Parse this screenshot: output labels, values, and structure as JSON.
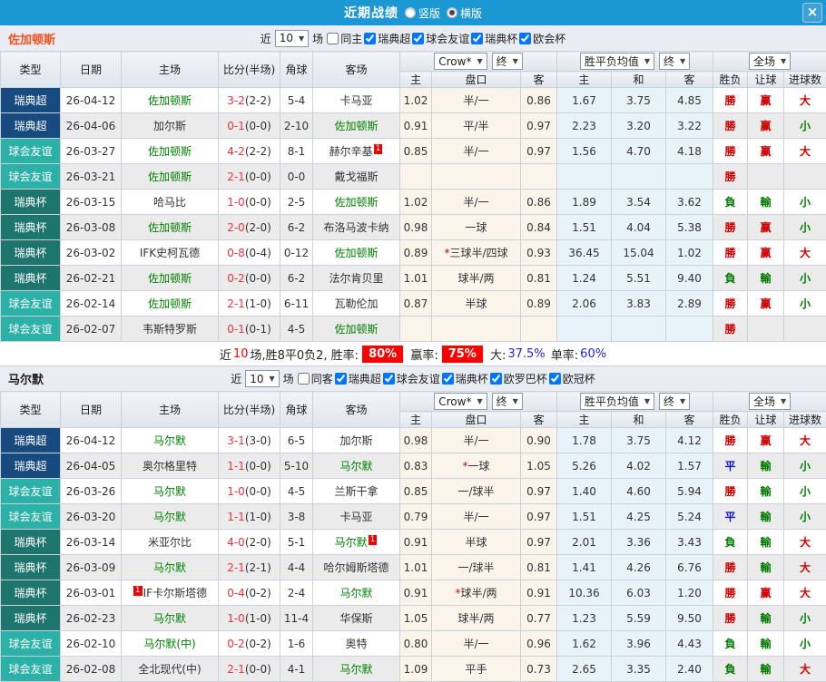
{
  "titlebar": {
    "title": "近期战绩",
    "radio_vertical": "竖版",
    "radio_horizontal": "横版",
    "selected": "横版",
    "close": "×"
  },
  "table_headers": {
    "type": "类型",
    "date": "日期",
    "home": "主场",
    "score": "比分(半场)",
    "corner": "角球",
    "away": "客场",
    "odds_home": "主",
    "handicap": "盘口",
    "odds_away": "客",
    "mean_home": "主",
    "mean_draw": "和",
    "mean_away": "客",
    "result": "胜负",
    "handicap_result": "让球",
    "goals": "进球数",
    "select_crow": "Crow*",
    "select_final1": "终",
    "select_mean": "胜平负均值",
    "select_final2": "终",
    "select_scope": "全场"
  },
  "result_colors": {
    "勝": "#d00000",
    "負": "#007a00",
    "平": "#1414cc",
    "赢": "#d00000",
    "輸": "#007a00",
    "大": "#d00000",
    "小": "#007a00"
  },
  "league_colors": {
    "瑞典超": "#174a7f",
    "球会友谊": "#2cb1a8",
    "瑞典杯": "#1e756e"
  },
  "sections": [
    {
      "team": "佐加顿斯",
      "team_color": "#f94e1c",
      "filters": {
        "near_label": "近",
        "matches": "10",
        "unit_label": "场",
        "checkboxes": [
          {
            "label": "同主",
            "checked": false
          },
          {
            "label": "瑞典超",
            "checked": true
          },
          {
            "label": "球会友谊",
            "checked": true
          },
          {
            "label": "瑞典杯",
            "checked": true
          },
          {
            "label": "欧会杯",
            "checked": true
          }
        ]
      },
      "rows": [
        {
          "type": "瑞典超",
          "date": "26-04-12",
          "home": {
            "name": "佐加顿斯",
            "focus": true
          },
          "score": "3-2",
          "half": "(2-2)",
          "corner": "5-4",
          "away": {
            "name": "卡马亚"
          },
          "o1": "1.02",
          "hcap": "半/一",
          "o2": "0.86",
          "m1": "1.67",
          "m2": "3.75",
          "m3": "4.85",
          "res": "勝",
          "hres": "赢",
          "goals": "大"
        },
        {
          "type": "瑞典超",
          "date": "26-04-06",
          "home": {
            "name": "加尔斯"
          },
          "score": "0-1",
          "half": "(0-0)",
          "corner": "2-10",
          "away": {
            "name": "佐加顿斯",
            "focus": true
          },
          "o1": "0.91",
          "hcap": "平/半",
          "o2": "0.97",
          "m1": "2.23",
          "m2": "3.20",
          "m3": "3.22",
          "res": "勝",
          "hres": "赢",
          "goals": "小"
        },
        {
          "type": "球会友谊",
          "date": "26-03-27",
          "home": {
            "name": "佐加顿斯",
            "focus": true
          },
          "score": "4-2",
          "half": "(2-2)",
          "corner": "8-1",
          "away": {
            "name": "赫尔辛基",
            "sup": "1"
          },
          "o1": "0.85",
          "hcap": "半/一",
          "o2": "0.97",
          "m1": "1.56",
          "m2": "4.70",
          "m3": "4.18",
          "res": "勝",
          "hres": "赢",
          "goals": "大"
        },
        {
          "type": "球会友谊",
          "date": "26-03-21",
          "home": {
            "name": "佐加顿斯",
            "focus": true
          },
          "score": "2-1",
          "half": "(0-0)",
          "corner": "0-0",
          "away": {
            "name": "戴戈福斯"
          },
          "o1": "",
          "hcap": "",
          "o2": "",
          "m1": "",
          "m2": "",
          "m3": "",
          "res": "勝",
          "hres": "",
          "goals": ""
        },
        {
          "type": "瑞典杯",
          "date": "26-03-15",
          "home": {
            "name": "哈马比"
          },
          "score": "1-0",
          "half": "(0-0)",
          "corner": "2-5",
          "away": {
            "name": "佐加顿斯",
            "focus": true
          },
          "o1": "1.02",
          "hcap": "半/一",
          "o2": "0.86",
          "m1": "1.89",
          "m2": "3.54",
          "m3": "3.62",
          "res": "負",
          "hres": "輸",
          "goals": "小"
        },
        {
          "type": "瑞典杯",
          "date": "26-03-08",
          "home": {
            "name": "佐加顿斯",
            "focus": true
          },
          "score": "2-0",
          "half": "(2-0)",
          "corner": "6-2",
          "away": {
            "name": "布洛马波卡纳"
          },
          "o1": "0.98",
          "hcap": "一球",
          "o2": "0.84",
          "m1": "1.51",
          "m2": "4.04",
          "m3": "5.38",
          "res": "勝",
          "hres": "赢",
          "goals": "小"
        },
        {
          "type": "瑞典杯",
          "date": "26-03-02",
          "home": {
            "name": "IFK史柯瓦德"
          },
          "score": "0-8",
          "half": "(0-4)",
          "corner": "0-12",
          "away": {
            "name": "佐加顿斯",
            "focus": true
          },
          "o1": "0.89",
          "hcap": "*三球半/四球",
          "o2": "0.93",
          "m1": "36.45",
          "m2": "15.04",
          "m3": "1.02",
          "res": "勝",
          "hres": "赢",
          "goals": "大"
        },
        {
          "type": "瑞典杯",
          "date": "26-02-21",
          "home": {
            "name": "佐加顿斯",
            "focus": true
          },
          "score": "0-2",
          "half": "(0-0)",
          "corner": "6-2",
          "away": {
            "name": "法尔肯贝里"
          },
          "o1": "1.01",
          "hcap": "球半/两",
          "o2": "0.81",
          "m1": "1.24",
          "m2": "5.51",
          "m3": "9.40",
          "res": "負",
          "hres": "輸",
          "goals": "小"
        },
        {
          "type": "球会友谊",
          "date": "26-02-14",
          "home": {
            "name": "佐加顿斯",
            "focus": true
          },
          "score": "2-1",
          "half": "(1-0)",
          "corner": "6-11",
          "away": {
            "name": "瓦勒伦加"
          },
          "o1": "0.87",
          "hcap": "半球",
          "o2": "0.89",
          "m1": "2.06",
          "m2": "3.83",
          "m3": "2.89",
          "res": "勝",
          "hres": "赢",
          "goals": "小"
        },
        {
          "type": "球会友谊",
          "date": "26-02-07",
          "home": {
            "name": "韦斯特罗斯"
          },
          "score": "0-1",
          "half": "(0-1)",
          "corner": "4-5",
          "away": {
            "name": "佐加顿斯",
            "focus": true
          },
          "o1": "",
          "hcap": "",
          "o2": "",
          "m1": "",
          "m2": "",
          "m3": "",
          "res": "勝",
          "hres": "",
          "goals": ""
        }
      ],
      "summary": {
        "p1": "近",
        "p2": "10",
        "p3": "场,胜8平0负2, 胜率:",
        "p4": "80%",
        "p5": " 赢率:",
        "p6": "75%",
        "p7": " 大:",
        "p8": "37.5%",
        "p9": " 单率:",
        "p10": "60%"
      }
    },
    {
      "team": "马尔默",
      "team_color": "#222222",
      "filters": {
        "near_label": "近",
        "matches": "10",
        "unit_label": "场",
        "checkboxes": [
          {
            "label": "同客",
            "checked": false
          },
          {
            "label": "瑞典超",
            "checked": true
          },
          {
            "label": "球会友谊",
            "checked": true
          },
          {
            "label": "瑞典杯",
            "checked": true
          },
          {
            "label": "欧罗巴杯",
            "checked": true
          },
          {
            "label": "欧冠杯",
            "checked": true
          }
        ]
      },
      "rows": [
        {
          "type": "瑞典超",
          "date": "26-04-12",
          "home": {
            "name": "马尔默",
            "focus": true
          },
          "score": "3-1",
          "half": "(3-0)",
          "corner": "6-5",
          "away": {
            "name": "加尔斯"
          },
          "o1": "0.98",
          "hcap": "半/一",
          "o2": "0.90",
          "m1": "1.78",
          "m2": "3.75",
          "m3": "4.12",
          "res": "勝",
          "hres": "赢",
          "goals": "大"
        },
        {
          "type": "瑞典超",
          "date": "26-04-05",
          "home": {
            "name": "奥尔格里特"
          },
          "score": "1-1",
          "half": "(0-0)",
          "corner": "5-10",
          "away": {
            "name": "马尔默",
            "focus": true
          },
          "o1": "0.83",
          "hcap": "*一球",
          "o2": "1.05",
          "m1": "5.26",
          "m2": "4.02",
          "m3": "1.57",
          "res": "平",
          "hres": "輸",
          "goals": "小"
        },
        {
          "type": "球会友谊",
          "date": "26-03-26",
          "home": {
            "name": "马尔默",
            "focus": true
          },
          "score": "1-0",
          "half": "(0-0)",
          "corner": "4-5",
          "away": {
            "name": "兰斯干拿"
          },
          "o1": "0.85",
          "hcap": "一/球半",
          "o2": "0.97",
          "m1": "1.40",
          "m2": "4.60",
          "m3": "5.94",
          "res": "勝",
          "hres": "輸",
          "goals": "小"
        },
        {
          "type": "球会友谊",
          "date": "26-03-20",
          "home": {
            "name": "马尔默",
            "focus": true
          },
          "score": "1-1",
          "half": "(1-0)",
          "corner": "3-8",
          "away": {
            "name": "卡马亚"
          },
          "o1": "0.79",
          "hcap": "半/一",
          "o2": "0.97",
          "m1": "1.51",
          "m2": "4.25",
          "m3": "5.24",
          "res": "平",
          "hres": "輸",
          "goals": "小"
        },
        {
          "type": "瑞典杯",
          "date": "26-03-14",
          "home": {
            "name": "米亚尔比"
          },
          "score": "4-0",
          "half": "(2-0)",
          "corner": "5-1",
          "away": {
            "name": "马尔默",
            "focus": true,
            "sup": "1"
          },
          "o1": "0.91",
          "hcap": "半球",
          "o2": "0.97",
          "m1": "2.01",
          "m2": "3.36",
          "m3": "3.43",
          "res": "負",
          "hres": "輸",
          "goals": "大"
        },
        {
          "type": "瑞典杯",
          "date": "26-03-09",
          "home": {
            "name": "马尔默",
            "focus": true
          },
          "score": "2-1",
          "half": "(2-1)",
          "corner": "4-4",
          "away": {
            "name": "哈尔姆斯塔德"
          },
          "o1": "1.01",
          "hcap": "一/球半",
          "o2": "0.81",
          "m1": "1.41",
          "m2": "4.26",
          "m3": "6.76",
          "res": "勝",
          "hres": "輸",
          "goals": "大"
        },
        {
          "type": "瑞典杯",
          "date": "26-03-01",
          "home": {
            "name": "IF卡尔斯塔德",
            "sup": "1",
            "sup_before": true
          },
          "score": "0-4",
          "half": "(0-2)",
          "corner": "2-4",
          "away": {
            "name": "马尔默",
            "focus": true
          },
          "o1": "0.91",
          "hcap": "*球半/两",
          "o2": "0.91",
          "m1": "10.36",
          "m2": "6.03",
          "m3": "1.20",
          "res": "勝",
          "hres": "赢",
          "goals": "大"
        },
        {
          "type": "瑞典杯",
          "date": "26-02-23",
          "home": {
            "name": "马尔默",
            "focus": true
          },
          "score": "1-0",
          "half": "(1-0)",
          "corner": "11-4",
          "away": {
            "name": "华保斯"
          },
          "o1": "1.05",
          "hcap": "球半/两",
          "o2": "0.77",
          "m1": "1.23",
          "m2": "5.59",
          "m3": "9.50",
          "res": "勝",
          "hres": "輸",
          "goals": "小"
        },
        {
          "type": "球会友谊",
          "date": "26-02-10",
          "home": {
            "name": "马尔默(中)",
            "focus": true
          },
          "score": "0-2",
          "half": "(0-2)",
          "corner": "1-6",
          "away": {
            "name": "奥特"
          },
          "o1": "0.80",
          "hcap": "半/一",
          "o2": "0.96",
          "m1": "1.62",
          "m2": "3.96",
          "m3": "4.43",
          "res": "負",
          "hres": "輸",
          "goals": "小"
        },
        {
          "type": "球会友谊",
          "date": "26-02-08",
          "home": {
            "name": "全北现代(中)"
          },
          "score": "2-1",
          "half": "(0-0)",
          "corner": "4-1",
          "away": {
            "name": "马尔默",
            "focus": true
          },
          "o1": "1.09",
          "hcap": "平手",
          "o2": "0.73",
          "m1": "2.65",
          "m2": "3.35",
          "m3": "2.40",
          "res": "負",
          "hres": "輸",
          "goals": "大"
        }
      ]
    }
  ]
}
